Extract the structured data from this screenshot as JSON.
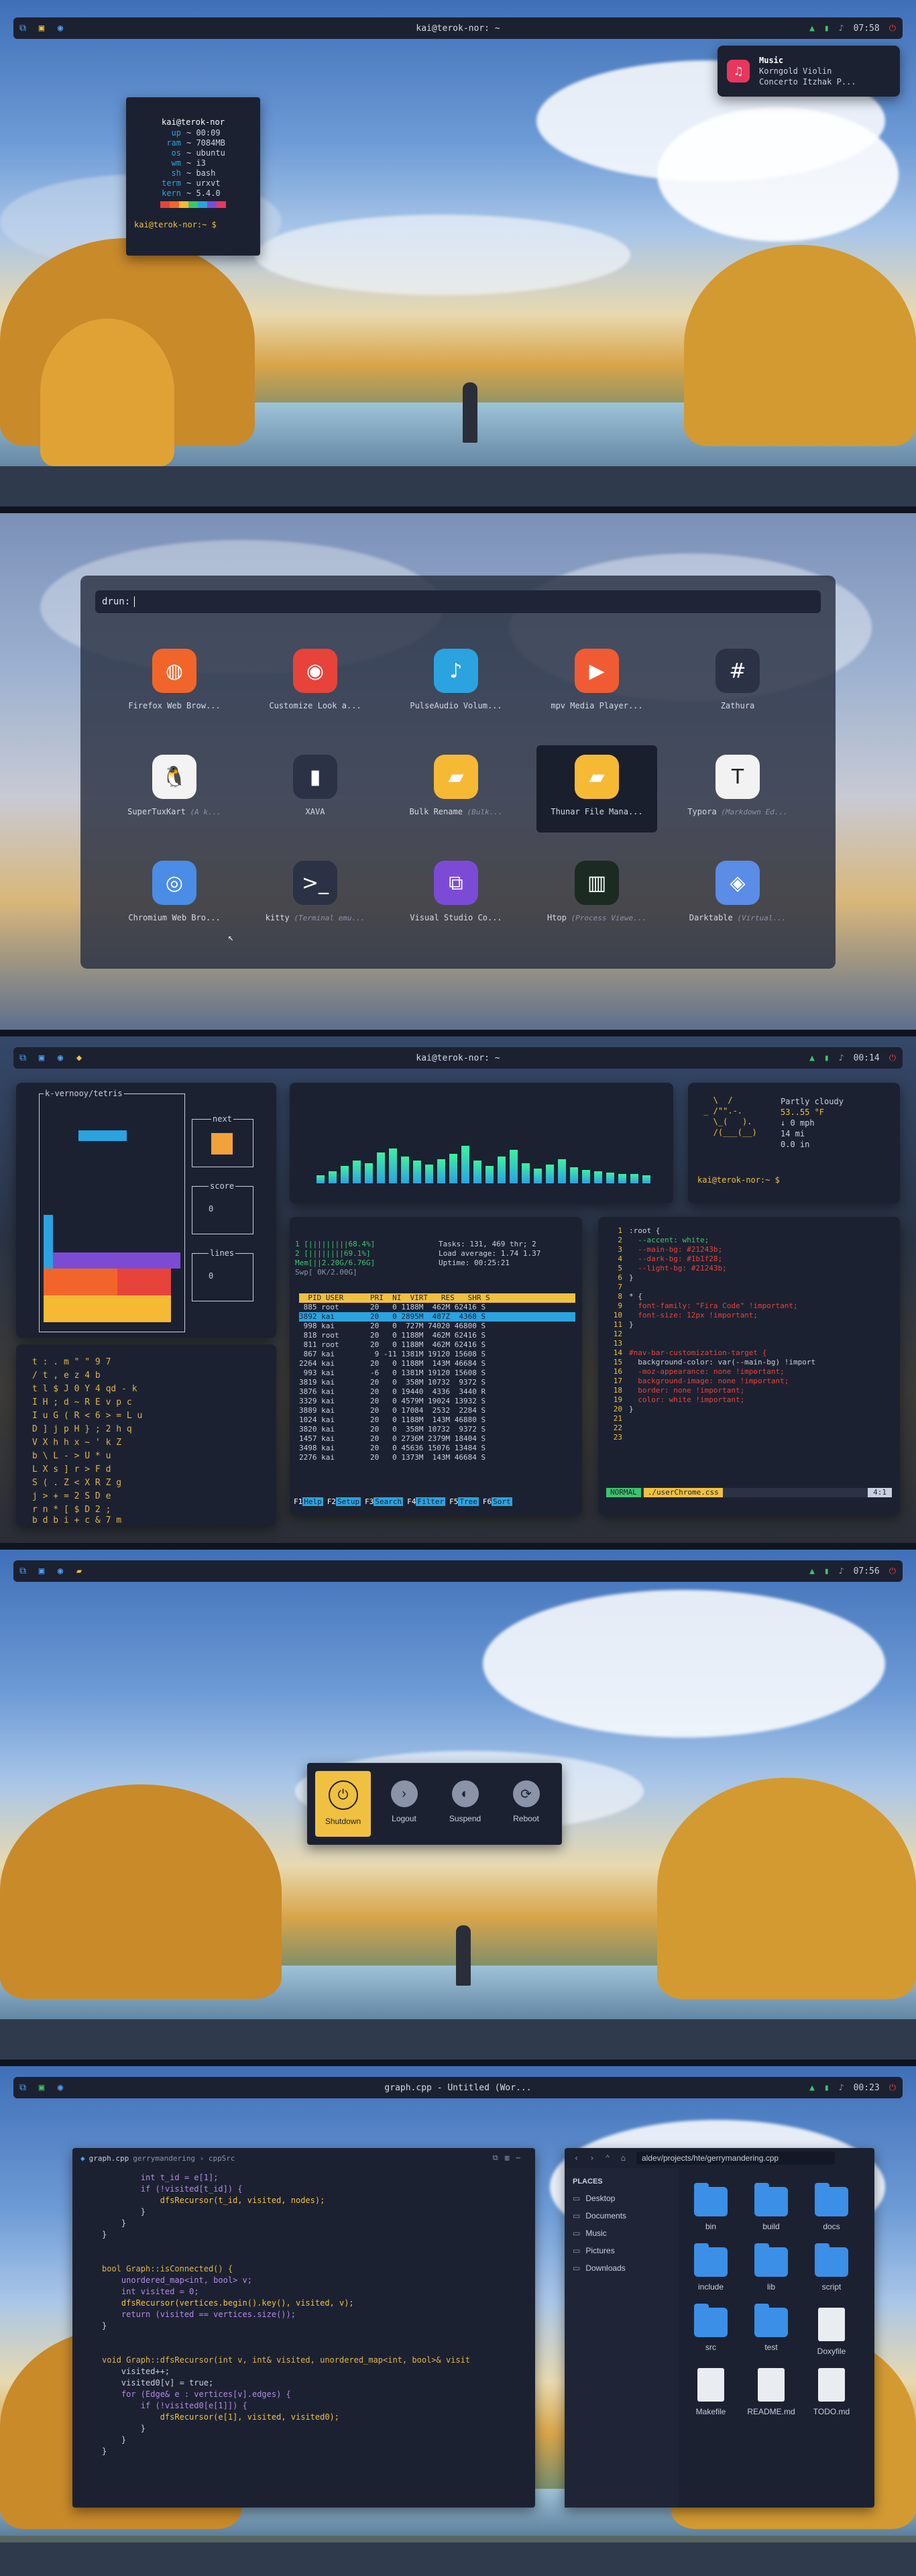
{
  "panels": [
    {
      "bar": {
        "title": "kai@terok-nor: ~",
        "time": "07:58"
      }
    },
    {
      "bar": null
    },
    {
      "bar": {
        "title": "kai@terok-nor: ~",
        "time": "00:14"
      }
    },
    {
      "bar": {
        "title": "",
        "time": "07:56"
      }
    },
    {
      "bar": {
        "title": "graph.cpp - Untitled (Wor...",
        "time": "00:23"
      }
    }
  ],
  "notification": {
    "app": "Music",
    "line1": "Korngold  Violin",
    "line2": "Concerto  Itzhak P..."
  },
  "neofetch": {
    "header": "kai@terok-nor",
    "rows": [
      {
        "k": "up",
        "v": "00:09"
      },
      {
        "k": "ram",
        "v": "7084MB"
      },
      {
        "k": "os",
        "v": "ubuntu"
      },
      {
        "k": "wm",
        "v": "i3"
      },
      {
        "k": "sh",
        "v": "bash"
      },
      {
        "k": "term",
        "v": "urxvt"
      },
      {
        "k": "kern",
        "v": "5.4.0"
      }
    ],
    "prompt": "kai@terok-nor:~ $"
  },
  "launcher": {
    "prompt": "drun:",
    "apps": [
      {
        "name": "Firefox Web Brow...",
        "sub": "",
        "icon": "firefox-icon",
        "color": "#f2652a"
      },
      {
        "name": "Customize Look a...",
        "sub": "",
        "icon": "customize-icon",
        "color": "#e8433b"
      },
      {
        "name": "PulseAudio Volum...",
        "sub": "",
        "icon": "pulseaudio-icon",
        "color": "#2aa3e0"
      },
      {
        "name": "mpv Media Player...",
        "sub": "",
        "icon": "mpv-icon",
        "color": "#f15b33"
      },
      {
        "name": "Zathura",
        "sub": "",
        "icon": "zathura-icon",
        "color": "#2b3245"
      },
      {
        "name": "SuperTuxKart",
        "sub": "(A k...",
        "icon": "tux-icon",
        "color": "#f3f3f3"
      },
      {
        "name": "XAVA",
        "sub": "",
        "icon": "xava-icon",
        "color": "#2b3245"
      },
      {
        "name": "Bulk Rename",
        "sub": "(Bulk...",
        "icon": "folder-icon",
        "color": "#f6b934"
      },
      {
        "name": "Thunar File Mana...",
        "sub": "",
        "icon": "thunar-icon",
        "color": "#f6b934"
      },
      {
        "name": "Typora",
        "sub": "(Markdown Ed...",
        "icon": "typora-icon",
        "color": "#f2f2f2"
      },
      {
        "name": "Chromium Web Bro...",
        "sub": "",
        "icon": "chromium-icon",
        "color": "#4b8ce6"
      },
      {
        "name": "kitty",
        "sub": "(Terminal emu...",
        "icon": "kitty-icon",
        "color": "#2b3245"
      },
      {
        "name": "Visual Studio Co...",
        "sub": "",
        "icon": "vscode-icon",
        "color": "#7b4bd6"
      },
      {
        "name": "Htop",
        "sub": "(Process Viewe...",
        "icon": "htop-icon",
        "color": "#1b2b22"
      },
      {
        "name": "Darktable",
        "sub": "(Virtual...",
        "icon": "darktable-icon",
        "color": "#5b8ce6"
      }
    ]
  },
  "tetris": {
    "title": "k-vernooy/tetris",
    "next": "next",
    "score_label": "score",
    "score": "0",
    "lines_label": "lines",
    "lines": "0"
  },
  "weather": {
    "desc": "Partly cloudy",
    "temp": "53..55 °F",
    "wind": "↓ 0 mph",
    "dist": "14 mi",
    "rain": "0.0 in",
    "prompt": "kai@terok-nor:~ $"
  },
  "htop": {
    "cpu1": "1  [|||||||||68.4%]",
    "cpu2": "2  [||||||||69.1%]",
    "mem": "Mem[||2.20G/6.76G]",
    "swp": "Swp[       0K/2.00G]",
    "tasks": "Tasks: 131, 469 thr; 2",
    "load": "Load average: 1.74 1.37",
    "uptime": "Uptime: 00:25:21",
    "header": "  PID USER      PRI  NI  VIRT   RES   SHR S",
    "rows": [
      " 885 root       20   0 1188M  462M 62416 S",
      "3892 kai        20   0 2895M  487Z  4368 S",
      " 998 kai        20   0  727M 74020 46800 S",
      " 818 root       20   0 1188M  462M 62416 S",
      " 811 root       20   0 1188M  462M 62416 S",
      " 867 kai         9 -11 1381M 19120 15608 S",
      "2264 kai        20   0 1188M  143M 46684 S",
      " 993 kai        -6   0 1381M 19120 15608 S",
      "3819 kai        20   0  358M 10732  9372 S",
      "3876 kai        20   0 19440  4336  3440 R",
      "3329 kai        20   0 4579M 19024 13932 S",
      "3889 kai        20   0 17084  2532  2284 S",
      "1024 kai        20   0 1188M  143M 46880 S",
      "3820 kai        20   0  358M 10732  9372 S",
      "1457 kai        20   0 2736M 2379M 18404 S",
      "3498 kai        20   0 45636 15076 13484 S",
      "2276 kai        20   0 1373M  143M 46684 S"
    ],
    "footer": [
      "F1Help",
      "F2Setup",
      "F3Search",
      "F4Filter",
      "F5Tree",
      "F6Sort"
    ]
  },
  "vim": {
    "lines": [
      {
        "n": "1",
        "t": ":root {"
      },
      {
        "n": "2",
        "t": "  --accent: white;"
      },
      {
        "n": "3",
        "t": "  --main-bg: #21243b;"
      },
      {
        "n": "4",
        "t": "  --dark-bg: #1b1f28;"
      },
      {
        "n": "5",
        "t": "  --light-bg: #21243b;"
      },
      {
        "n": "6",
        "t": "}"
      },
      {
        "n": "7",
        "t": ""
      },
      {
        "n": "8",
        "t": "* {"
      },
      {
        "n": "9",
        "t": "  font-family: \"Fira Code\" !important;"
      },
      {
        "n": "10",
        "t": "  font-size: 12px !important;"
      },
      {
        "n": "11",
        "t": "}"
      },
      {
        "n": "12",
        "t": ""
      },
      {
        "n": "13",
        "t": ""
      },
      {
        "n": "14",
        "t": "#nav-bar-customization-target {"
      },
      {
        "n": "15",
        "t": "  background-color: var(--main-bg) !import"
      },
      {
        "n": "16",
        "t": "  -moz-appearance: none !important;"
      },
      {
        "n": "17",
        "t": "  background-image: none !important;"
      },
      {
        "n": "18",
        "t": "  border: none !important;"
      },
      {
        "n": "19",
        "t": "  color: white !important;"
      },
      {
        "n": "20",
        "t": "}"
      },
      {
        "n": "21",
        "t": ""
      },
      {
        "n": "22",
        "t": ""
      },
      {
        "n": "23",
        "t": ""
      }
    ],
    "mode": "NORMAL",
    "file": "./userChrome.css",
    "pos": "4:1"
  },
  "power": [
    {
      "label": "Shutdown",
      "icon": "power-icon"
    },
    {
      "label": "Logout",
      "icon": "logout-icon"
    },
    {
      "label": "Suspend",
      "icon": "suspend-icon"
    },
    {
      "label": "Reboot",
      "icon": "reboot-icon"
    }
  ],
  "editor": {
    "tab": "graph.cpp",
    "tab_path": "gerrymandering › cppSrc",
    "code": [
      "        int t_id = e[1];",
      "        if (!visited[t_id]) {",
      "            dfsRecursor(t_id, visited, nodes);",
      "        }",
      "    }",
      "}",
      "",
      "",
      "bool Graph::isConnected() {",
      "    unordered_map<int, bool> v;",
      "    int visited = 0;",
      "    dfsRecursor(vertices.begin().key(), visited, v);",
      "    return (visited == vertices.size());",
      "}",
      "",
      "",
      "void Graph::dfsRecursor(int v, int& visited, unordered_map<int, bool>& visit",
      "    visited++;",
      "    visited0[v] = true;",
      "    for (Edge& e : vertices[v].edges) {",
      "        if (!visited0[e[1]]) {",
      "            dfsRecursor(e[1], visited, visited0);",
      "        }",
      "    }",
      "}"
    ]
  },
  "files": {
    "path": "aldev/projects/hte/gerrymandering.cpp",
    "places_label": "PLACES",
    "places": [
      "Desktop",
      "Documents",
      "Music",
      "Pictures",
      "Downloads"
    ],
    "items": [
      {
        "name": "bin",
        "type": "folder"
      },
      {
        "name": "build",
        "type": "folder"
      },
      {
        "name": "docs",
        "type": "folder"
      },
      {
        "name": "include",
        "type": "folder"
      },
      {
        "name": "lib",
        "type": "folder"
      },
      {
        "name": "script",
        "type": "folder"
      },
      {
        "name": "src",
        "type": "folder"
      },
      {
        "name": "test",
        "type": "folder"
      },
      {
        "name": "Doxyfile",
        "type": "file"
      },
      {
        "name": "Makefile",
        "type": "file"
      },
      {
        "name": "README.md",
        "type": "file"
      },
      {
        "name": "TODO.md",
        "type": "file"
      }
    ]
  }
}
